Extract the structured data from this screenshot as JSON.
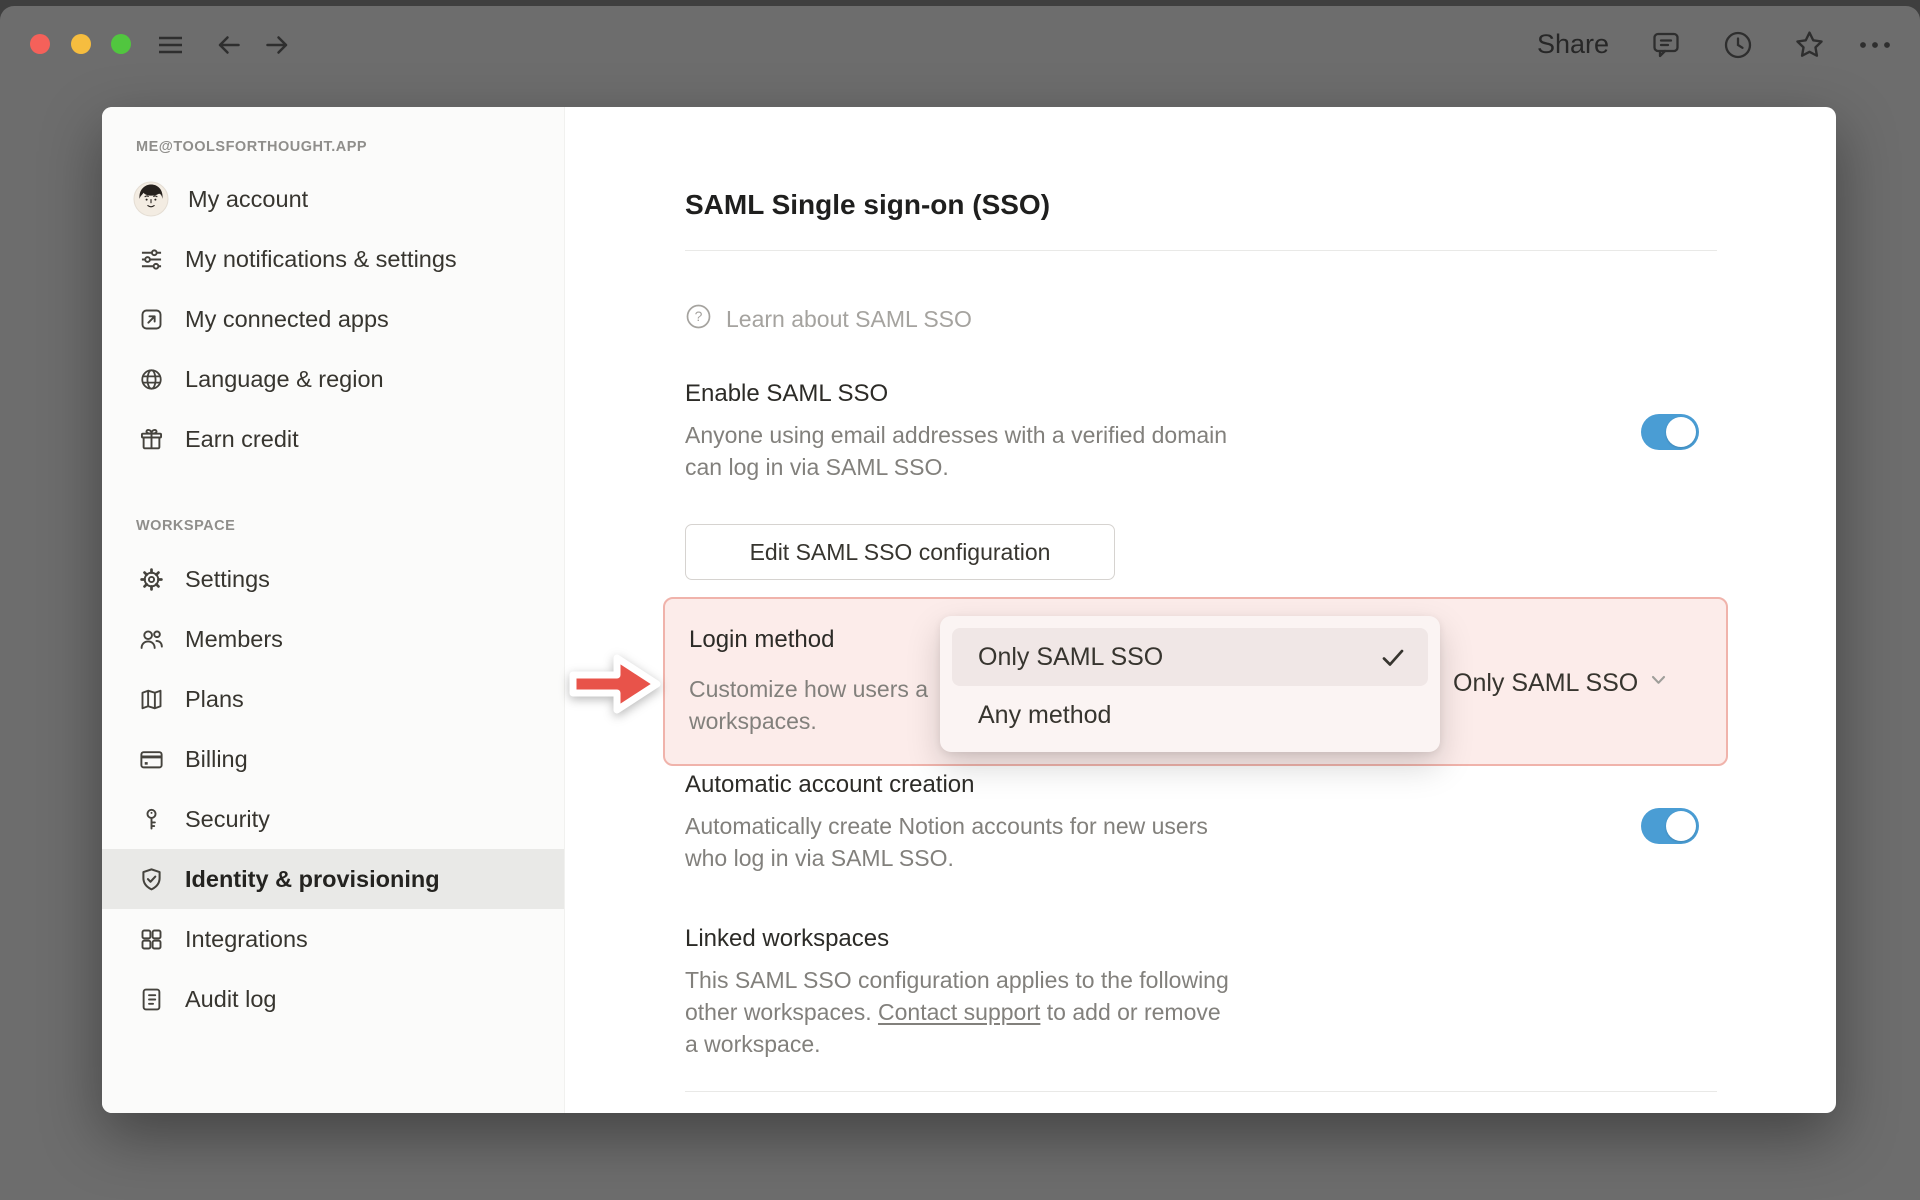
{
  "topbar": {
    "share_label": "Share",
    "icons": [
      "close",
      "minimize",
      "zoom",
      "hamburger-menu",
      "back-arrow",
      "forward-arrow",
      "comments",
      "history-clock",
      "favorite-star",
      "more-ellipsis"
    ]
  },
  "sidebar": {
    "account_header": "ME@TOOLSFORTHOUGHT.APP",
    "account_items": [
      {
        "label": "My account",
        "icon": "avatar"
      },
      {
        "label": "My notifications & settings",
        "icon": "sliders"
      },
      {
        "label": "My connected apps",
        "icon": "external-link-square"
      },
      {
        "label": "Language & region",
        "icon": "globe"
      },
      {
        "label": "Earn credit",
        "icon": "gift"
      }
    ],
    "workspace_header": "WORKSPACE",
    "workspace_items": [
      {
        "label": "Settings",
        "icon": "gear"
      },
      {
        "label": "Members",
        "icon": "people"
      },
      {
        "label": "Plans",
        "icon": "map"
      },
      {
        "label": "Billing",
        "icon": "credit-card"
      },
      {
        "label": "Security",
        "icon": "key"
      },
      {
        "label": "Identity & provisioning",
        "icon": "shield-check",
        "active": true
      },
      {
        "label": "Integrations",
        "icon": "grid"
      },
      {
        "label": "Audit log",
        "icon": "document-list"
      }
    ]
  },
  "main": {
    "title": "SAML Single sign-on (SSO)",
    "learn_link": "Learn about SAML SSO",
    "enable_saml": {
      "title": "Enable SAML SSO",
      "description_line1": "Anyone using email addresses with a verified domain",
      "description_line2": "can log in via SAML SSO.",
      "toggle": "on"
    },
    "edit_button_label": "Edit SAML SSO configuration",
    "login_method": {
      "title": "Login method",
      "description_visible_line1": "Customize how users a",
      "description_visible_line2": "workspaces.",
      "selected_value": "Only SAML SSO",
      "options": [
        {
          "label": "Only SAML SSO",
          "selected": true
        },
        {
          "label": "Any method",
          "selected": false
        }
      ]
    },
    "automatic_account_creation": {
      "title": "Automatic account creation",
      "description_line1": "Automatically create Notion accounts for new users",
      "description_line2": "who log in via SAML SSO.",
      "toggle": "on"
    },
    "linked_workspaces": {
      "title": "Linked workspaces",
      "description_line1": "This SAML SSO configuration applies to the following",
      "description_line2_before_link": "other workspaces. ",
      "description_line2_link": "Contact support",
      "description_line2_after_link": " to add or remove",
      "description_line3": "a workspace."
    }
  },
  "colors": {
    "toggle_on_blue": "#4a9dd4",
    "highlight_background": "#fcecea",
    "highlight_border": "#f0b3ab",
    "annotation_arrow_red": "#e8534a",
    "active_item_background": "#e9e9e7",
    "traffic_red": "#f5615a",
    "traffic_yellow": "#f6bd3f",
    "traffic_green": "#51c63f"
  }
}
